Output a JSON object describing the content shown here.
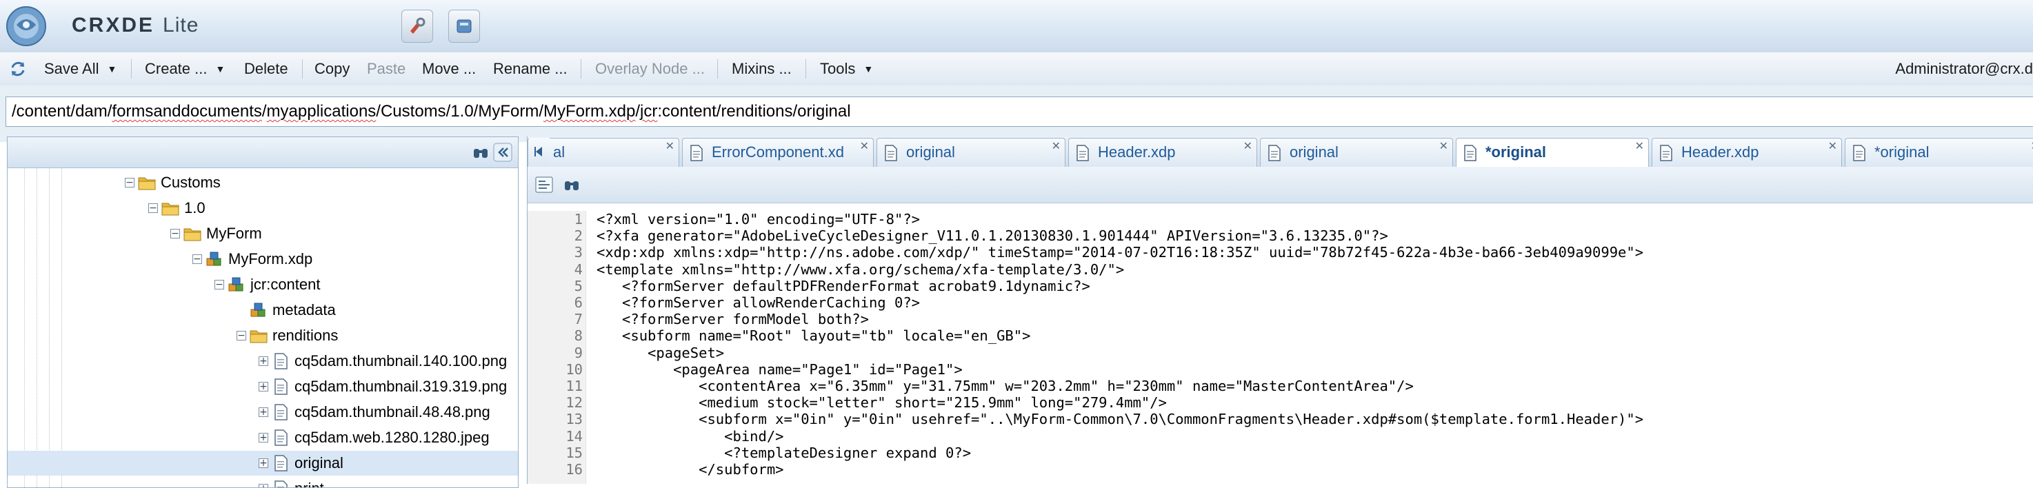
{
  "app": {
    "brand_primary": "CRXDE",
    "brand_secondary": "Lite"
  },
  "toolbar": {
    "items": [
      {
        "label": "Save All",
        "dropdown": true,
        "disabled": false
      },
      {
        "label": "Create ...",
        "dropdown": true,
        "disabled": false
      },
      {
        "label": "Delete",
        "dropdown": false,
        "disabled": false
      },
      {
        "label": "Copy",
        "dropdown": false,
        "disabled": false
      },
      {
        "label": "Paste",
        "dropdown": false,
        "disabled": true
      },
      {
        "label": "Move ...",
        "dropdown": false,
        "disabled": false
      },
      {
        "label": "Rename ...",
        "dropdown": false,
        "disabled": false
      },
      {
        "label": "Overlay Node ...",
        "dropdown": false,
        "disabled": true
      },
      {
        "label": "Mixins ...",
        "dropdown": false,
        "disabled": false
      },
      {
        "label": "Tools",
        "dropdown": true,
        "disabled": false
      }
    ],
    "user": "Administrator@crx.d"
  },
  "path": {
    "p1": "/content/dam/",
    "p2": "formsanddocuments",
    "p3": "/",
    "p4": "myapplications",
    "p5": "/Customs/1.0/MyForm/",
    "p6": "MyForm.xdp",
    "p7": "/",
    "p8": "jcr",
    "p9": ":content/renditions/original"
  },
  "tree": {
    "nodes": [
      {
        "label": "Customs",
        "level": 0,
        "icon": "folder-icon",
        "expanded": true
      },
      {
        "label": "1.0",
        "level": 1,
        "icon": "folder-icon",
        "expanded": true
      },
      {
        "label": "MyForm",
        "level": 2,
        "icon": "folder-icon",
        "expanded": true
      },
      {
        "label": "MyForm.xdp",
        "level": 3,
        "icon": "asset-node-icon",
        "expanded": true
      },
      {
        "label": "jcr:content",
        "level": 4,
        "icon": "asset-node-icon",
        "expanded": true
      },
      {
        "label": "metadata",
        "level": 5,
        "icon": "asset-node-icon",
        "expanded": null
      },
      {
        "label": "renditions",
        "level": 5,
        "icon": "folder-icon",
        "expanded": true
      },
      {
        "label": "cq5dam.thumbnail.140.100.png",
        "level": 6,
        "icon": "file-icon",
        "expanded": false
      },
      {
        "label": "cq5dam.thumbnail.319.319.png",
        "level": 6,
        "icon": "file-icon",
        "expanded": false
      },
      {
        "label": "cq5dam.thumbnail.48.48.png",
        "level": 6,
        "icon": "file-icon",
        "expanded": false
      },
      {
        "label": "cq5dam.web.1280.1280.jpeg",
        "level": 6,
        "icon": "file-icon",
        "expanded": false
      },
      {
        "label": "original",
        "level": 6,
        "icon": "file-icon",
        "expanded": false,
        "selected": true
      },
      {
        "label": "print",
        "level": 6,
        "icon": "file-icon",
        "expanded": false
      }
    ]
  },
  "tabs": [
    {
      "label": "al",
      "active": false
    },
    {
      "label": "ErrorComponent.xd",
      "active": false
    },
    {
      "label": "original",
      "active": false
    },
    {
      "label": "Header.xdp",
      "active": false
    },
    {
      "label": "original",
      "active": false
    },
    {
      "label": "*original",
      "active": true
    },
    {
      "label": "Header.xdp",
      "active": false
    },
    {
      "label": "*original",
      "active": false
    }
  ],
  "code": {
    "lines": [
      {
        "n": "1",
        "text": "<?xml version=\"1.0\" encoding=\"UTF-8\"?>"
      },
      {
        "n": "2",
        "text": "<?xfa generator=\"AdobeLiveCycleDesigner_V11.0.1.20130830.1.901444\" APIVersion=\"3.6.13235.0\"?>"
      },
      {
        "n": "3",
        "text": "<xdp:xdp xmlns:xdp=\"http://ns.adobe.com/xdp/\" timeStamp=\"2014-07-02T16:18:35Z\" uuid=\"78b72f45-622a-4b3e-ba66-3eb409a9099e\">"
      },
      {
        "n": "4",
        "text": "<template xmlns=\"http://www.xfa.org/schema/xfa-template/3.0/\">"
      },
      {
        "n": "5",
        "text": "   <?formServer defaultPDFRenderFormat acrobat9.1dynamic?>"
      },
      {
        "n": "6",
        "text": "   <?formServer allowRenderCaching 0?>"
      },
      {
        "n": "7",
        "text": "   <?formServer formModel both?>"
      },
      {
        "n": "8",
        "text": "   <subform name=\"Root\" layout=\"tb\" locale=\"en_GB\">"
      },
      {
        "n": "9",
        "text": "      <pageSet>"
      },
      {
        "n": "10",
        "text": "         <pageArea name=\"Page1\" id=\"Page1\">"
      },
      {
        "n": "11",
        "text": "            <contentArea x=\"6.35mm\" y=\"31.75mm\" w=\"203.2mm\" h=\"230mm\" name=\"MasterContentArea\"/>"
      },
      {
        "n": "12",
        "text": "            <medium stock=\"letter\" short=\"215.9mm\" long=\"279.4mm\"/>"
      },
      {
        "n": "13",
        "text": "            <subform x=\"0in\" y=\"0in\" usehref=\"..\\MyForm-Common\\7.0\\CommonFragments\\Header.xdp#som($template.form1.Header)\">"
      },
      {
        "n": "14",
        "text": "               <bind/>"
      },
      {
        "n": "15",
        "text": "               <?templateDesigner expand 0?>"
      },
      {
        "n": "16",
        "text": "            </subform>"
      }
    ]
  },
  "colors": {
    "accent": "#1a4f8a",
    "selection": "#d8e6f5",
    "header_bg": "#d9e6f3"
  }
}
